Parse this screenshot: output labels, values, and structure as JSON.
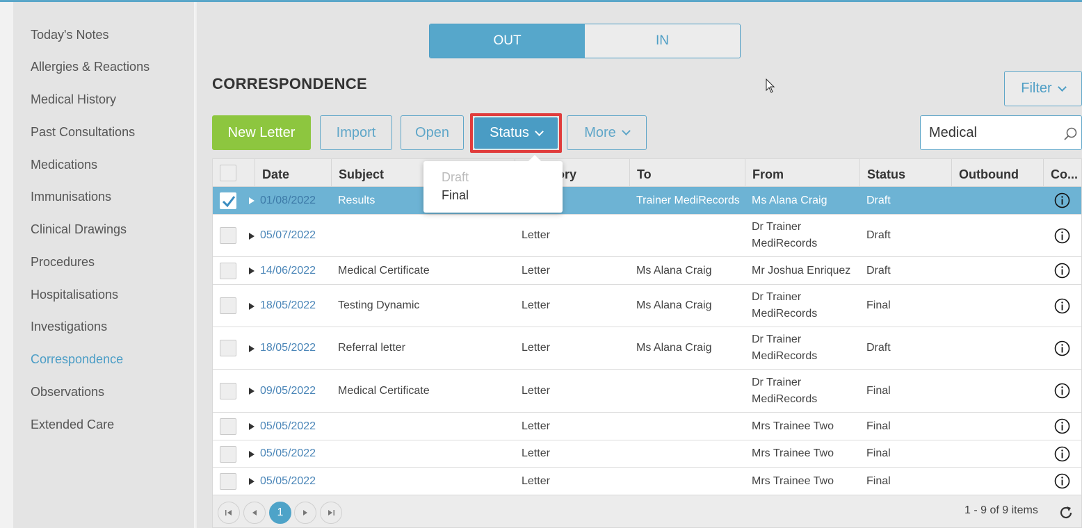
{
  "sidebar": {
    "items": [
      {
        "label": "Today's Notes"
      },
      {
        "label": "Allergies & Reactions"
      },
      {
        "label": "Medical History"
      },
      {
        "label": "Past Consultations"
      },
      {
        "label": "Medications"
      },
      {
        "label": "Immunisations"
      },
      {
        "label": "Clinical Drawings"
      },
      {
        "label": "Procedures"
      },
      {
        "label": "Hospitalisations"
      },
      {
        "label": "Investigations"
      },
      {
        "label": "Correspondence",
        "active": true
      },
      {
        "label": "Observations"
      },
      {
        "label": "Extended Care"
      }
    ]
  },
  "toggle": {
    "out_label": "OUT",
    "in_label": "IN",
    "selected": "OUT"
  },
  "page_title": "CORRESPONDENCE",
  "toolbar": {
    "new_letter": "New Letter",
    "import": "Import",
    "open": "Open",
    "status": "Status",
    "more": "More",
    "filter": "Filter"
  },
  "search": {
    "value": "Medical"
  },
  "status_dropdown": {
    "options": [
      {
        "label": "Draft",
        "disabled": true
      },
      {
        "label": "Final",
        "disabled": false
      }
    ]
  },
  "grid": {
    "columns": [
      "Date",
      "Subject",
      "Category",
      "To",
      "From",
      "Status",
      "Outbound",
      "Co..."
    ],
    "rows": [
      {
        "date": "01/08/2022",
        "subject": "Results",
        "category": "",
        "to": "Trainer MediRecords",
        "from": "Ms Alana Craig",
        "status": "Draft",
        "selected": true
      },
      {
        "date": "05/07/2022",
        "subject": "",
        "category": "Letter",
        "to": "",
        "from": "Dr Trainer MediRecords",
        "status": "Draft",
        "selected": false
      },
      {
        "date": "14/06/2022",
        "subject": "Medical Certificate",
        "category": "Letter",
        "to": "Ms Alana Craig",
        "from": "Mr Joshua Enriquez",
        "status": "Draft",
        "selected": false
      },
      {
        "date": "18/05/2022",
        "subject": "Testing Dynamic",
        "category": "Letter",
        "to": "Ms Alana Craig",
        "from": "Dr Trainer MediRecords",
        "status": "Final",
        "selected": false
      },
      {
        "date": "18/05/2022",
        "subject": "Referral letter",
        "category": "Letter",
        "to": "Ms Alana Craig",
        "from": "Dr Trainer MediRecords",
        "status": "Draft",
        "selected": false
      },
      {
        "date": "09/05/2022",
        "subject": "Medical Certificate",
        "category": "Letter",
        "to": "",
        "from": "Dr Trainer MediRecords",
        "status": "Final",
        "selected": false
      },
      {
        "date": "05/05/2022",
        "subject": "",
        "category": "Letter",
        "to": "",
        "from": "Mrs Trainee Two",
        "status": "Final",
        "selected": false
      },
      {
        "date": "05/05/2022",
        "subject": "",
        "category": "Letter",
        "to": "",
        "from": "Mrs Trainee Two",
        "status": "Final",
        "selected": false
      },
      {
        "date": "05/05/2022",
        "subject": "",
        "category": "Letter",
        "to": "",
        "from": "Mrs Trainee Two",
        "status": "Final",
        "selected": false
      }
    ]
  },
  "pager": {
    "current_page": "1",
    "summary": "1 - 9 of 9 items"
  },
  "colors": {
    "accent": "#4a9cc4",
    "new_letter": "#8dc63f",
    "highlight_border": "#e03c3c",
    "selected_row": "#6db3d4"
  }
}
